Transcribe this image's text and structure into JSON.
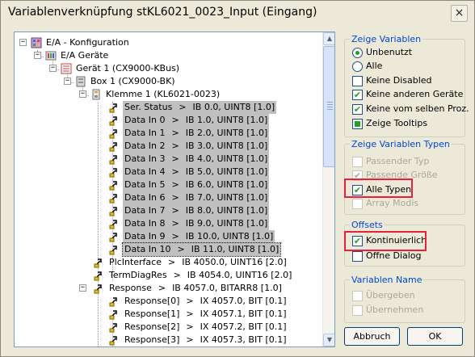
{
  "window": {
    "title": "Variablenverknüpfung stKL6021_0023_Input (Eingang)"
  },
  "icons": {
    "close": "×",
    "expanded": "−",
    "scroll_up": "▲",
    "scroll_down": "▼"
  },
  "tree": {
    "rows": [
      {
        "label": "E/A - Konfiguration"
      },
      {
        "label": "E/A Geräte"
      },
      {
        "label": "Gerät 1 (CX9000-KBus)"
      },
      {
        "label": "Box 1 (CX9000-BK)"
      },
      {
        "label": "Klemme 1 (KL6021-0023)"
      },
      {
        "name": "Ser. Status",
        "sep": ">",
        "value": "IB 0.0, UINT8 [1.0]"
      },
      {
        "name": "Data In 0",
        "sep": ">",
        "value": "IB 1.0, UINT8 [1.0]"
      },
      {
        "name": "Data In 1",
        "sep": ">",
        "value": "IB 2.0, UINT8 [1.0]"
      },
      {
        "name": "Data In 2",
        "sep": ">",
        "value": "IB 3.0, UINT8 [1.0]"
      },
      {
        "name": "Data In 3",
        "sep": ">",
        "value": "IB 4.0, UINT8 [1.0]"
      },
      {
        "name": "Data In 4",
        "sep": ">",
        "value": "IB 5.0, UINT8 [1.0]"
      },
      {
        "name": "Data In 5",
        "sep": ">",
        "value": "IB 6.0, UINT8 [1.0]"
      },
      {
        "name": "Data In 6",
        "sep": ">",
        "value": "IB 7.0, UINT8 [1.0]"
      },
      {
        "name": "Data In 7",
        "sep": ">",
        "value": "IB 8.0, UINT8 [1.0]"
      },
      {
        "name": "Data In 8",
        "sep": ">",
        "value": "IB 9.0, UINT8 [1.0]"
      },
      {
        "name": "Data In 9",
        "sep": ">",
        "value": "IB 10.0, UINT8 [1.0]"
      },
      {
        "name": "Data In 10",
        "sep": ">",
        "value": "IB 11.0, UINT8 [1.0]"
      },
      {
        "name": "PlcInterface",
        "sep": ">",
        "value": "IB 4050.0, UINT16 [2.0]"
      },
      {
        "name": "TermDiagRes",
        "sep": ">",
        "value": "IB 4054.0, UINT16 [2.0]"
      },
      {
        "name": "Response",
        "sep": ">",
        "value": "IB 4057.0, BITARR8 [1.0]"
      },
      {
        "name": "Response[0]",
        "sep": ">",
        "value": "IX 4057.0, BIT [0.1]"
      },
      {
        "name": "Response[1]",
        "sep": ">",
        "value": "IX 4057.1, BIT [0.1]"
      },
      {
        "name": "Response[2]",
        "sep": ">",
        "value": "IX 4057.2, BIT [0.1]"
      },
      {
        "name": "Response[3]",
        "sep": ">",
        "value": "IX 4057.3, BIT [0.1]"
      }
    ]
  },
  "zeige_variablen": {
    "title": "Zeige Variablen",
    "unbenutzt": "Unbenutzt",
    "alle": "Alle",
    "keine_disabled": "Keine Disabled",
    "keine_anderen": "Keine anderen Geräte",
    "keine_selben": "Keine vom selben Proz.",
    "tooltips": "Zeige Tooltips"
  },
  "zeige_typen": {
    "title": "Zeige Variablen Typen",
    "passender_typ": "Passender Typ",
    "passende_groesse": "Passende Größe",
    "alle_typen": "Alle Typen",
    "array_modis": "Array Modis"
  },
  "offsets": {
    "title": "Offsets",
    "kontinuierlich": "Kontinuierlich",
    "offne_dialog": "Öffne Dialog"
  },
  "variablen_name": {
    "title": "Variablen Name",
    "uebergeben": "Übergeben",
    "uebernehmen": "Übernehmen"
  },
  "buttons": {
    "abbruch": "Abbruch",
    "ok": "OK"
  }
}
